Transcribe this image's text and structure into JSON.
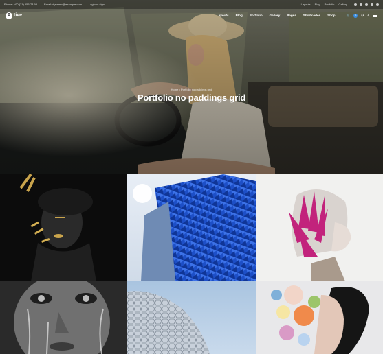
{
  "topbar": {
    "phone": "Phone: +00 (21) 555-78 93",
    "email": "Email: dynamic@example.com",
    "login": "Login or sign",
    "links": [
      "Layouts",
      "Blog",
      "Portfolio",
      "Gallery"
    ]
  },
  "brand": {
    "name": "tive",
    "mark": "A"
  },
  "nav": {
    "items": [
      "Layouts",
      "Blog",
      "Portfolio",
      "Gallery",
      "Pages",
      "Shortcodes",
      "Shop"
    ],
    "cart_count": "0"
  },
  "hero": {
    "breadcrumb": "Home  •  Portfolio no paddings grid",
    "title": "Portfolio no paddings grid"
  },
  "colors": {
    "accent": "#3a8de0"
  }
}
